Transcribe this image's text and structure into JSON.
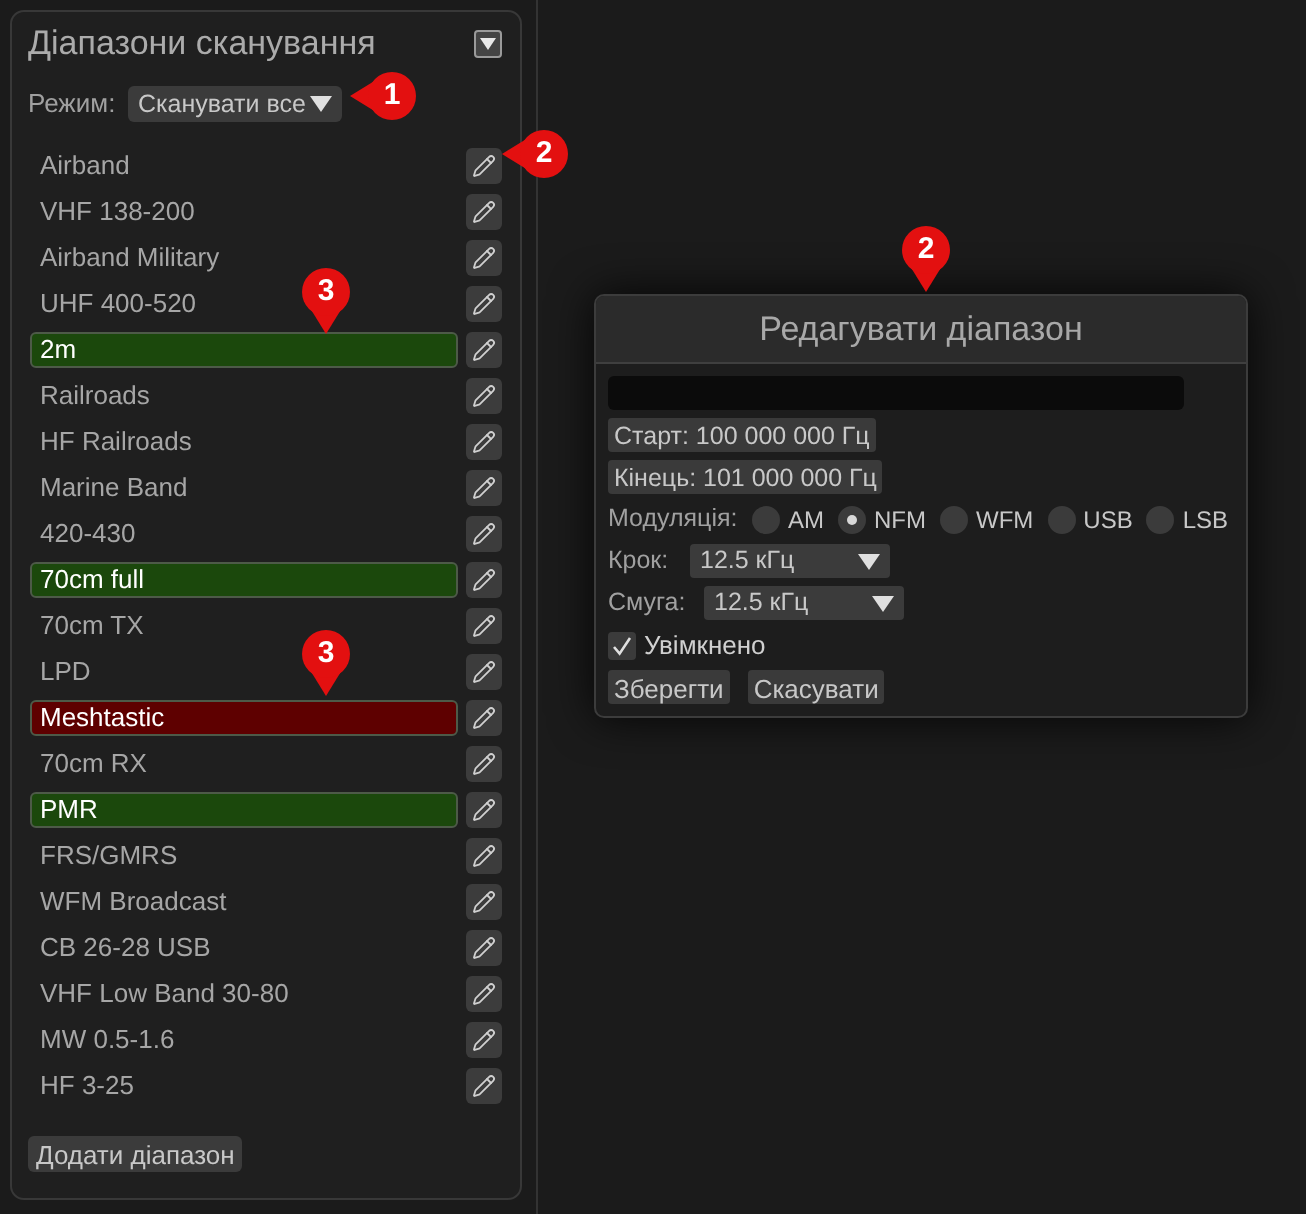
{
  "panel": {
    "title": "Діапазони сканування"
  },
  "mode": {
    "label": "Режим:",
    "value": "Сканувати все"
  },
  "ranges": [
    {
      "name": "Airband"
    },
    {
      "name": "VHF 138-200"
    },
    {
      "name": "Airband Military"
    },
    {
      "name": "UHF 400-520"
    },
    {
      "name": "2m",
      "color": "#1b480c"
    },
    {
      "name": "Railroads"
    },
    {
      "name": "HF Railroads"
    },
    {
      "name": "Marine Band"
    },
    {
      "name": "420-430"
    },
    {
      "name": "70cm full",
      "color": "#1b480c"
    },
    {
      "name": "70cm TX"
    },
    {
      "name": "LPD"
    },
    {
      "name": "Meshtastic",
      "color": "#5e0000"
    },
    {
      "name": "70cm RX"
    },
    {
      "name": "PMR",
      "color": "#1b480c"
    },
    {
      "name": "FRS/GMRS"
    },
    {
      "name": "WFM Broadcast"
    },
    {
      "name": "CB 26-28 USB"
    },
    {
      "name": "VHF Low Band 30-80"
    },
    {
      "name": "MW 0.5-1.6"
    },
    {
      "name": "HF 3-25"
    }
  ],
  "add_button": "Додати діапазон",
  "dialog": {
    "title": "Редагувати діапазон",
    "start": "Старт: 100 000 000 Гц",
    "end": "Кінець: 101 000 000 Гц",
    "modulation": {
      "label": "Модуляція:",
      "options": [
        {
          "label": "AM",
          "selected": false
        },
        {
          "label": "NFM",
          "selected": true
        },
        {
          "label": "WFM",
          "selected": false
        },
        {
          "label": "USB",
          "selected": false
        },
        {
          "label": "LSB",
          "selected": false
        }
      ]
    },
    "step": {
      "label": "Крок:",
      "value": "12.5 кГц"
    },
    "bandwidth": {
      "label": "Смуга:",
      "value": "12.5 кГц"
    },
    "enabled": {
      "label": "Увімкнено",
      "checked": true
    },
    "buttons": [
      "Зберегти",
      "Скасувати"
    ]
  },
  "callouts": [
    {
      "label": "1"
    },
    {
      "label": "2"
    },
    {
      "label": "3"
    },
    {
      "label": "3"
    },
    {
      "label": "2"
    }
  ]
}
